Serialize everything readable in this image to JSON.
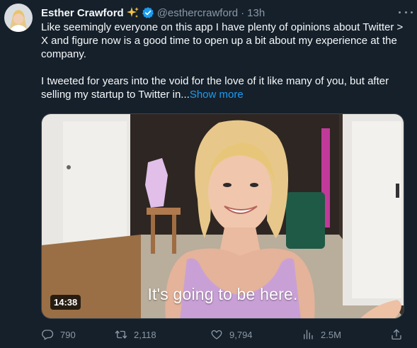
{
  "author": {
    "display_name": "Esther Crawford",
    "handle": "@esthercrawford",
    "separator": "·",
    "time": "13h"
  },
  "tweet": {
    "paragraph1": "Like seemingly everyone on this app I have plenty of opinions about Twitter > X and figure now is a good time to open up a bit about my experience at the company.",
    "paragraph2": "I tweeted for years into the void for the love of it like many of you, but after selling my startup to Twitter in...",
    "show_more": "Show more"
  },
  "media": {
    "duration": "14:38",
    "caption": "It's going to be here."
  },
  "actions": {
    "replies": "790",
    "retweets": "2,118",
    "likes": "9,794",
    "views": "2.5M"
  },
  "icons": {
    "sparkle": "sparkle-icon",
    "verified": "verified-badge-icon",
    "more": "more-icon",
    "reply": "reply-icon",
    "retweet": "retweet-icon",
    "like": "heart-icon",
    "views": "views-icon",
    "share": "share-icon"
  },
  "colors": {
    "background": "#15202b",
    "text": "#f7f9f9",
    "muted": "#8b98a5",
    "accent": "#1d9bf0",
    "sparkle": "#f4c542"
  }
}
